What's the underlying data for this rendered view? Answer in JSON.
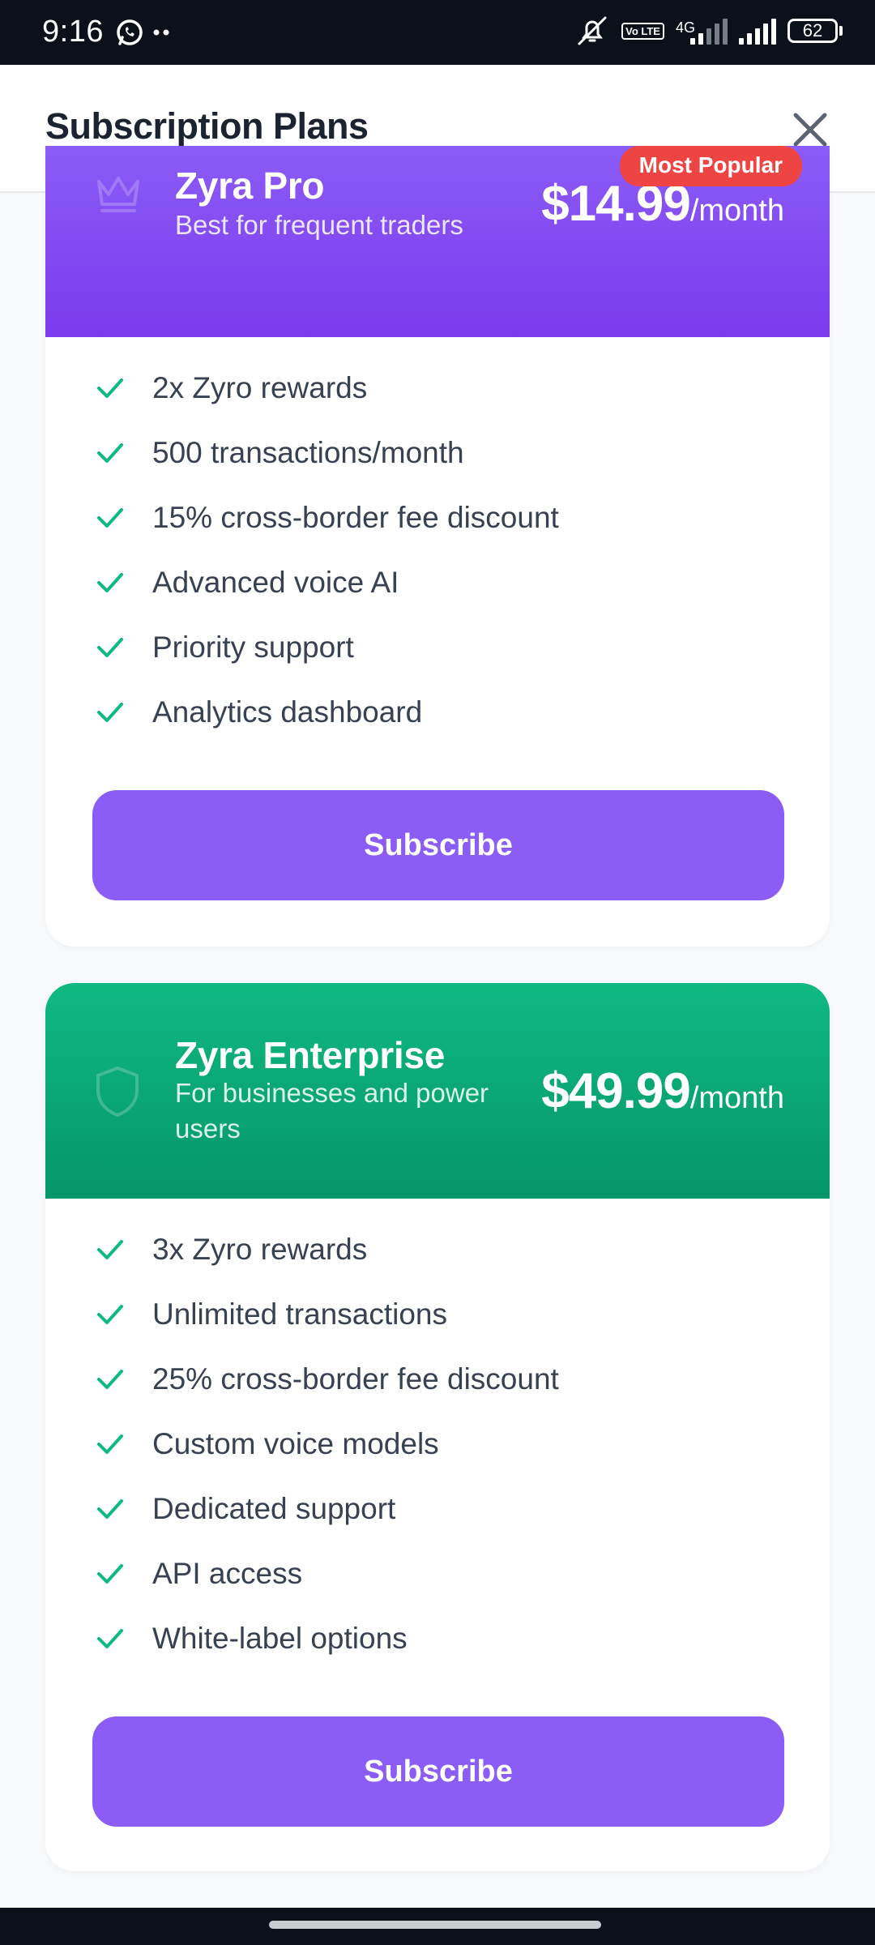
{
  "status_bar": {
    "time": "9:16",
    "network": "4G",
    "volte": "Vo LTE",
    "battery": "62"
  },
  "header": {
    "title": "Subscription Plans",
    "close_icon": "close-icon"
  },
  "plans": [
    {
      "name": "Zyra Pro",
      "description": "Best for frequent traders",
      "price": "$14.99",
      "period": "/month",
      "badge": "Most Popular",
      "icon": "crown-icon",
      "color": "#8b5cf6",
      "features": [
        "2x Zyro rewards",
        "500 transactions/month",
        "15% cross-border fee discount",
        "Advanced voice AI",
        "Priority support",
        "Analytics dashboard"
      ],
      "cta": "Subscribe"
    },
    {
      "name": "Zyra Enterprise",
      "description": "For businesses and power users",
      "price": "$49.99",
      "period": "/month",
      "icon": "shield-icon",
      "color": "#10b981",
      "features": [
        "3x Zyro rewards",
        "Unlimited transactions",
        "25% cross-border fee discount",
        "Custom voice models",
        "Dedicated support",
        "API access",
        "White-label options"
      ],
      "cta": "Subscribe"
    }
  ],
  "colors": {
    "accent": "#8b5cf6",
    "check": "#10b981",
    "badge": "#ef4444"
  }
}
